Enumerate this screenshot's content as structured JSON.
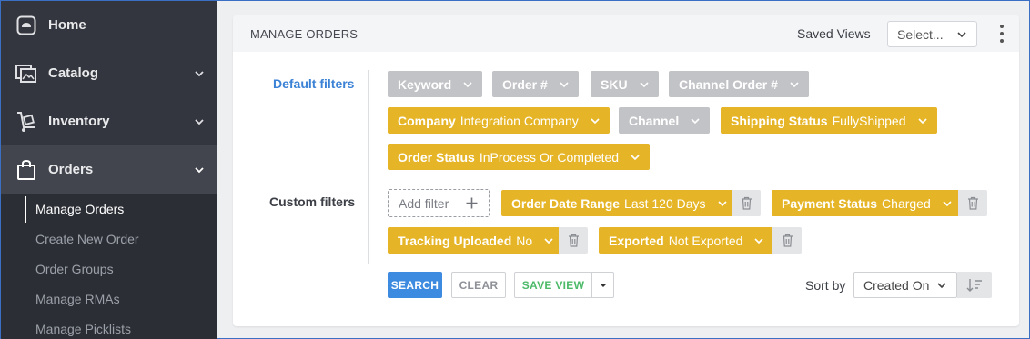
{
  "sidebar": {
    "items": [
      {
        "label": "Home",
        "icon": "home-icon"
      },
      {
        "label": "Catalog",
        "icon": "catalog-icon"
      },
      {
        "label": "Inventory",
        "icon": "inventory-icon"
      },
      {
        "label": "Orders",
        "icon": "shopping-bag-icon"
      }
    ],
    "sub_items": [
      "Manage Orders",
      "Create New Order",
      "Order Groups",
      "Manage RMAs",
      "Manage Picklists"
    ]
  },
  "header": {
    "title": "MANAGE ORDERS",
    "saved_views_label": "Saved Views",
    "saved_views_value": "Select..."
  },
  "filters": {
    "default_label": "Default filters",
    "custom_label": "Custom filters",
    "default": [
      {
        "key": "Keyword",
        "value": ""
      },
      {
        "key": "Order #",
        "value": ""
      },
      {
        "key": "SKU",
        "value": ""
      },
      {
        "key": "Channel Order #",
        "value": ""
      },
      {
        "key": "Company",
        "value": "Integration Company"
      },
      {
        "key": "Channel",
        "value": ""
      },
      {
        "key": "Shipping Status",
        "value": "FullyShipped"
      },
      {
        "key": "Order Status",
        "value": "InProcess Or Completed"
      }
    ],
    "add_filter_label": "Add filter",
    "custom": [
      {
        "key": "Order Date Range",
        "value": "Last 120 Days"
      },
      {
        "key": "Payment Status",
        "value": "Charged"
      },
      {
        "key": "Tracking Uploaded",
        "value": "No"
      },
      {
        "key": "Exported",
        "value": "Not Exported"
      }
    ]
  },
  "actions": {
    "search": "SEARCH",
    "clear": "CLEAR",
    "save_view": "SAVE VIEW",
    "sort_label": "Sort by",
    "sort_value": "Created On"
  },
  "colors": {
    "sidebar_bg": "#33363e",
    "chip_active": "#e6b527",
    "chip_inactive": "#c2c3c6",
    "accent_blue": "#3d8be0",
    "save_green": "#4cba68"
  }
}
